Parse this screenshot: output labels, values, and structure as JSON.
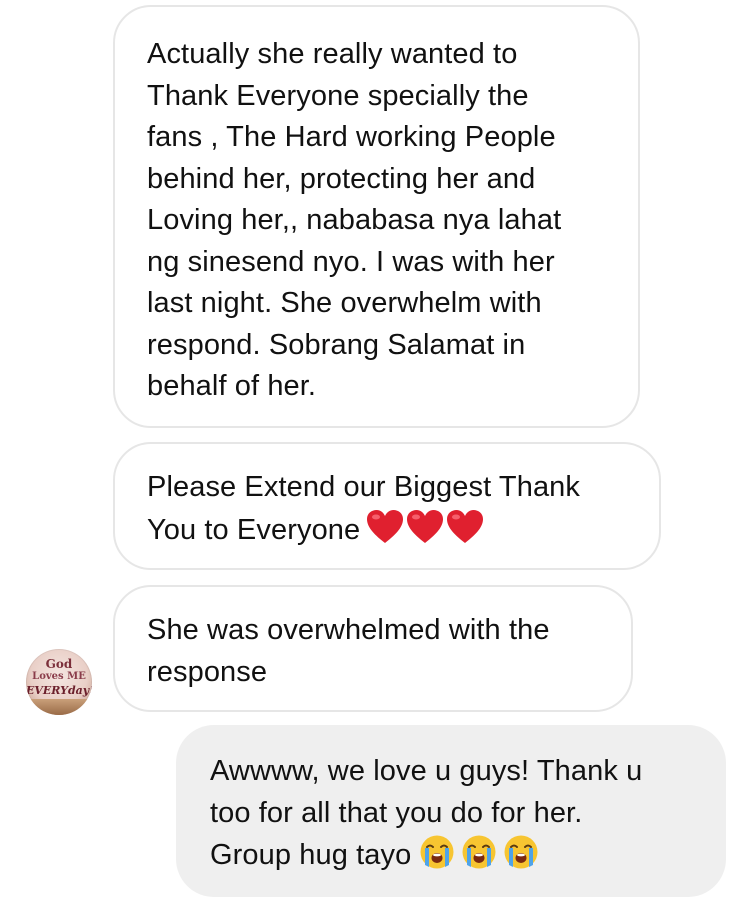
{
  "conversation": {
    "messages": [
      {
        "sender": "other",
        "lines": [
          "Actually she really wanted to",
          "Thank Everyone specially the",
          "fans , The Hard working People",
          "behind her, protecting her and",
          "Loving her,, nababasa nya lahat",
          "ng sinesend nyo. I was with her",
          "last night. She overwhelm with",
          "respond. Sobrang Salamat in",
          "behalf of her."
        ]
      },
      {
        "sender": "other",
        "lines": [
          "Please Extend our Biggest Thank",
          "You to Everyone"
        ],
        "trailing_emoji": [
          "red-heart-emoji",
          "red-heart-emoji",
          "red-heart-emoji"
        ]
      },
      {
        "sender": "other",
        "lines": [
          "She was overwhelmed with the",
          "response"
        ]
      },
      {
        "sender": "me",
        "lines": [
          "Awwww, we love u guys! Thank u",
          "too for all that you do for her.",
          "Group hug tayo"
        ],
        "trailing_emoji": [
          "loudly-crying-face-emoji",
          "loudly-crying-face-emoji",
          "loudly-crying-face-emoji"
        ]
      }
    ],
    "avatar": {
      "lettering": [
        "God",
        "Loves ME",
        "EVERYday!"
      ]
    }
  },
  "colors": {
    "incoming_bubble_border": "#e6e6e6",
    "outgoing_bubble_fill": "#efefef",
    "text": "#111111",
    "heart": "#e0202f",
    "emoji_face": "#f7c531",
    "tears": "#4fa3e8"
  }
}
